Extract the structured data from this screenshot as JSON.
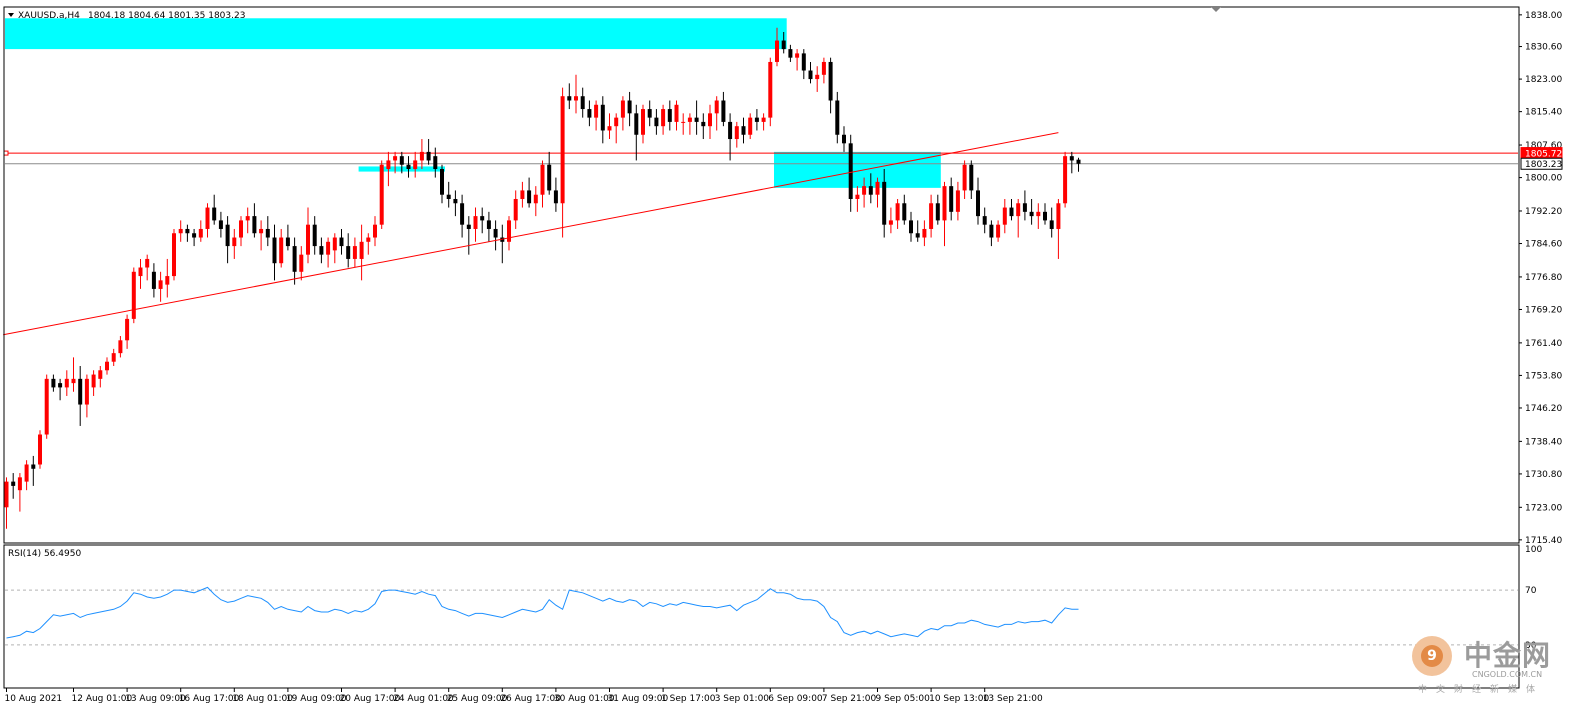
{
  "header": {
    "symbol": "XAUUSD.a,H4",
    "ohlc": "1804.18 1804.64 1801.35 1803.23"
  },
  "rsi": {
    "label": "RSI(14) 56.4950",
    "levels": [
      100,
      70,
      30
    ],
    "level_labels": [
      "100",
      "70",
      "30"
    ]
  },
  "watermark": {
    "brand": "中金网",
    "url": "CNGOLD.COM.CN",
    "tagline": "中文财经新媒体"
  },
  "colors": {
    "bull": "#ff0000",
    "bear": "#000000",
    "zone": "#00ffff",
    "trendline": "#ff0000",
    "rsi": "#1e90ff",
    "resistance_tag": "#ff0000",
    "bid_tag": "#ffffff"
  },
  "chart_data": {
    "type": "candlestick",
    "y_ticks": [
      1838.0,
      1830.6,
      1823.0,
      1815.4,
      1807.6,
      1800.0,
      1792.2,
      1784.6,
      1776.8,
      1769.2,
      1761.4,
      1753.8,
      1746.2,
      1738.4,
      1730.8,
      1723.0,
      1715.4
    ],
    "y_tick_labels": [
      "1838.00",
      "1830.60",
      "1823.00",
      "1815.40",
      "1807.60",
      "1800.00",
      "1792.20",
      "1784.60",
      "1776.80",
      "1769.20",
      "1761.40",
      "1753.80",
      "1746.20",
      "1738.40",
      "1730.80",
      "1723.00",
      "1715.40"
    ],
    "ylim": [
      1714.9,
      1839.6
    ],
    "x_labels": [
      "10 Aug 2021",
      "12 Aug 01:00",
      "13 Aug 09:00",
      "16 Aug 17:00",
      "18 Aug 01:00",
      "19 Aug 09:00",
      "20 Aug 17:00",
      "24 Aug 01:00",
      "25 Aug 09:00",
      "26 Aug 17:00",
      "30 Aug 01:00",
      "31 Aug 09:00",
      "1 Sep 17:00",
      "3 Sep 01:00",
      "6 Sep 09:00",
      "7 Sep 21:00",
      "9 Sep 05:00",
      "10 Sep 13:00",
      "13 Sep 21:00"
    ],
    "x_label_index": [
      0,
      10,
      18,
      26,
      34,
      42,
      50,
      58,
      66,
      74,
      82,
      90,
      98,
      106,
      114,
      122,
      130,
      138,
      146
    ],
    "price_tags": [
      {
        "label": "1805.72",
        "value": 1805.72,
        "style": "resistance"
      },
      {
        "label": "1803.23",
        "value": 1803.23,
        "style": "bid"
      }
    ],
    "zones": [
      {
        "from_bar": 0,
        "to_bar": 116,
        "low": 1830.0,
        "high": 1837.2
      },
      {
        "from_bar": 53,
        "to_bar": 65,
        "low": 1801.4,
        "high": 1802.6
      },
      {
        "from_bar": 115,
        "to_bar": 139,
        "low": 1797.6,
        "high": 1806.0
      }
    ],
    "trendline": {
      "x1_bar": -0.5,
      "y1": 1763.3,
      "x2_bar": 157,
      "y2": 1810.5
    },
    "ohlc": [
      [
        1723.0,
        1730.0,
        1718.0,
        1729.0
      ],
      [
        1729.0,
        1731.0,
        1725.0,
        1728.0
      ],
      [
        1727.0,
        1731.0,
        1722.0,
        1730.0
      ],
      [
        1729.0,
        1734.0,
        1727.0,
        1733.0
      ],
      [
        1733.0,
        1735.0,
        1728.0,
        1732.0
      ],
      [
        1733.0,
        1741.0,
        1732.0,
        1740.0
      ],
      [
        1740.0,
        1754.0,
        1739.0,
        1753.0
      ],
      [
        1753.0,
        1754.0,
        1750.0,
        1751.0
      ],
      [
        1752.0,
        1753.0,
        1748.0,
        1751.0
      ],
      [
        1751.0,
        1755.0,
        1749.0,
        1753.0
      ],
      [
        1752.0,
        1758.0,
        1750.0,
        1753.0
      ],
      [
        1753.0,
        1756.0,
        1742.0,
        1747.0
      ],
      [
        1747.0,
        1754.0,
        1744.0,
        1753.0
      ],
      [
        1751.0,
        1755.0,
        1749.0,
        1754.0
      ],
      [
        1753.0,
        1756.0,
        1751.0,
        1755.0
      ],
      [
        1755.0,
        1758.0,
        1754.0,
        1757.0
      ],
      [
        1757.0,
        1760.0,
        1756.0,
        1759.0
      ],
      [
        1759.0,
        1763.0,
        1758.0,
        1762.0
      ],
      [
        1762.0,
        1768.0,
        1760.0,
        1767.0
      ],
      [
        1767.0,
        1779.0,
        1766.0,
        1778.0
      ],
      [
        1777.0,
        1781.0,
        1774.0,
        1779.0
      ],
      [
        1779.0,
        1782.0,
        1776.0,
        1781.0
      ],
      [
        1778.0,
        1780.0,
        1772.0,
        1774.0
      ],
      [
        1774.0,
        1778.0,
        1771.0,
        1776.0
      ],
      [
        1775.0,
        1781.0,
        1772.0,
        1777.0
      ],
      [
        1777.0,
        1788.0,
        1776.0,
        1787.0
      ],
      [
        1787.0,
        1790.0,
        1785.0,
        1788.0
      ],
      [
        1788.0,
        1789.0,
        1785.0,
        1787.0
      ],
      [
        1787.0,
        1788.0,
        1784.0,
        1786.0
      ],
      [
        1786.0,
        1790.0,
        1785.0,
        1788.0
      ],
      [
        1788.0,
        1794.0,
        1786.0,
        1793.0
      ],
      [
        1793.0,
        1796.0,
        1789.0,
        1790.0
      ],
      [
        1790.0,
        1792.0,
        1786.0,
        1788.0
      ],
      [
        1789.0,
        1791.0,
        1780.0,
        1784.0
      ],
      [
        1784.0,
        1788.0,
        1781.0,
        1786.0
      ],
      [
        1786.0,
        1791.0,
        1784.0,
        1790.0
      ],
      [
        1790.0,
        1793.0,
        1787.0,
        1791.0
      ],
      [
        1791.0,
        1794.0,
        1786.0,
        1787.0
      ],
      [
        1787.0,
        1790.0,
        1783.0,
        1788.0
      ],
      [
        1788.0,
        1791.0,
        1784.0,
        1786.0
      ],
      [
        1786.0,
        1789.0,
        1776.0,
        1780.0
      ],
      [
        1780.0,
        1788.0,
        1779.0,
        1786.0
      ],
      [
        1786.0,
        1789.0,
        1783.0,
        1784.0
      ],
      [
        1784.0,
        1786.0,
        1775.0,
        1778.0
      ],
      [
        1778.0,
        1784.0,
        1776.0,
        1782.0
      ],
      [
        1782.0,
        1793.0,
        1780.0,
        1789.0
      ],
      [
        1789.0,
        1791.0,
        1782.0,
        1784.0
      ],
      [
        1784.0,
        1786.0,
        1780.0,
        1782.0
      ],
      [
        1782.0,
        1786.0,
        1779.0,
        1785.0
      ],
      [
        1783.0,
        1787.0,
        1780.0,
        1786.0
      ],
      [
        1786.0,
        1788.0,
        1782.0,
        1784.0
      ],
      [
        1784.0,
        1787.0,
        1779.0,
        1781.0
      ],
      [
        1781.0,
        1786.0,
        1779.0,
        1784.0
      ],
      [
        1781.0,
        1789.0,
        1776.0,
        1785.0
      ],
      [
        1785.0,
        1787.0,
        1782.0,
        1786.0
      ],
      [
        1786.0,
        1791.0,
        1784.0,
        1789.0
      ],
      [
        1789.0,
        1804.0,
        1788.0,
        1803.0
      ],
      [
        1802.0,
        1806.0,
        1798.0,
        1804.0
      ],
      [
        1804.0,
        1806.0,
        1801.0,
        1805.0
      ],
      [
        1805.0,
        1806.0,
        1801.0,
        1803.0
      ],
      [
        1803.0,
        1805.0,
        1800.0,
        1802.0
      ],
      [
        1802.0,
        1806.0,
        1800.0,
        1804.0
      ],
      [
        1804.0,
        1809.0,
        1802.0,
        1806.0
      ],
      [
        1806.0,
        1809.0,
        1803.0,
        1804.0
      ],
      [
        1805.0,
        1807.0,
        1800.0,
        1802.0
      ],
      [
        1802.0,
        1803.0,
        1794.0,
        1796.0
      ],
      [
        1796.0,
        1799.0,
        1793.0,
        1795.0
      ],
      [
        1795.0,
        1797.0,
        1791.0,
        1794.0
      ],
      [
        1794.0,
        1796.0,
        1786.0,
        1789.0
      ],
      [
        1789.0,
        1791.0,
        1782.0,
        1788.0
      ],
      [
        1788.0,
        1793.0,
        1785.0,
        1791.0
      ],
      [
        1791.0,
        1793.0,
        1787.0,
        1790.0
      ],
      [
        1790.0,
        1792.0,
        1785.0,
        1788.0
      ],
      [
        1788.0,
        1790.0,
        1783.0,
        1786.0
      ],
      [
        1786.0,
        1789.0,
        1780.0,
        1785.0
      ],
      [
        1785.0,
        1791.0,
        1783.0,
        1790.0
      ],
      [
        1790.0,
        1797.0,
        1788.0,
        1795.0
      ],
      [
        1795.0,
        1799.0,
        1793.0,
        1797.0
      ],
      [
        1797.0,
        1800.0,
        1793.0,
        1794.0
      ],
      [
        1794.0,
        1798.0,
        1791.0,
        1796.0
      ],
      [
        1796.0,
        1804.0,
        1793.0,
        1803.0
      ],
      [
        1803.0,
        1806.0,
        1796.0,
        1797.0
      ],
      [
        1797.0,
        1800.0,
        1792.0,
        1794.0
      ],
      [
        1794.0,
        1821.0,
        1786.0,
        1819.0
      ],
      [
        1819.0,
        1822.0,
        1816.0,
        1818.0
      ],
      [
        1818.0,
        1824.0,
        1815.0,
        1819.0
      ],
      [
        1819.0,
        1821.0,
        1814.0,
        1816.0
      ],
      [
        1816.0,
        1818.0,
        1812.0,
        1814.0
      ],
      [
        1814.0,
        1818.0,
        1811.0,
        1817.0
      ],
      [
        1817.0,
        1819.0,
        1808.0,
        1811.0
      ],
      [
        1811.0,
        1815.0,
        1809.0,
        1812.0
      ],
      [
        1812.0,
        1815.0,
        1808.0,
        1814.0
      ],
      [
        1814.0,
        1819.0,
        1811.0,
        1818.0
      ],
      [
        1818.0,
        1820.0,
        1812.0,
        1815.0
      ],
      [
        1815.0,
        1817.0,
        1804.0,
        1810.0
      ],
      [
        1810.0,
        1817.0,
        1808.0,
        1816.0
      ],
      [
        1816.0,
        1818.0,
        1812.0,
        1814.0
      ],
      [
        1814.0,
        1816.0,
        1810.0,
        1812.0
      ],
      [
        1812.0,
        1817.0,
        1810.0,
        1816.0
      ],
      [
        1816.0,
        1818.0,
        1811.0,
        1813.0
      ],
      [
        1813.0,
        1818.0,
        1811.0,
        1817.0
      ],
      [
        1813.0,
        1815.0,
        1810.0,
        1813.0
      ],
      [
        1813.0,
        1815.0,
        1810.0,
        1814.0
      ],
      [
        1814.0,
        1818.0,
        1810.0,
        1813.0
      ],
      [
        1813.0,
        1815.0,
        1809.0,
        1812.0
      ],
      [
        1812.0,
        1817.0,
        1809.0,
        1815.0
      ],
      [
        1815.0,
        1819.0,
        1811.0,
        1818.0
      ],
      [
        1818.0,
        1820.0,
        1812.0,
        1813.0
      ],
      [
        1813.0,
        1815.0,
        1804.0,
        1809.0
      ],
      [
        1809.0,
        1813.0,
        1807.0,
        1812.0
      ],
      [
        1812.0,
        1814.0,
        1808.0,
        1810.0
      ],
      [
        1810.0,
        1815.0,
        1809.0,
        1814.0
      ],
      [
        1814.0,
        1816.0,
        1811.0,
        1813.0
      ],
      [
        1813.0,
        1815.0,
        1811.0,
        1814.0
      ],
      [
        1814.0,
        1828.0,
        1812.0,
        1827.0
      ],
      [
        1827.0,
        1835.0,
        1826.0,
        1832.0
      ],
      [
        1832.0,
        1834.0,
        1829.0,
        1830.0
      ],
      [
        1830.0,
        1831.0,
        1827.0,
        1828.0
      ],
      [
        1828.0,
        1830.0,
        1825.0,
        1829.0
      ],
      [
        1829.0,
        1830.0,
        1823.0,
        1825.0
      ],
      [
        1825.0,
        1827.0,
        1822.0,
        1823.0
      ],
      [
        1823.0,
        1826.0,
        1820.0,
        1824.0
      ],
      [
        1824.0,
        1828.0,
        1822.0,
        1827.0
      ],
      [
        1827.0,
        1828.0,
        1815.0,
        1818.0
      ],
      [
        1818.0,
        1820.0,
        1808.0,
        1810.0
      ],
      [
        1810.0,
        1812.0,
        1806.0,
        1808.0
      ],
      [
        1808.0,
        1810.0,
        1792.0,
        1795.0
      ],
      [
        1795.0,
        1798.0,
        1792.0,
        1796.0
      ],
      [
        1796.0,
        1800.0,
        1793.0,
        1798.0
      ],
      [
        1798.0,
        1801.0,
        1794.0,
        1796.0
      ],
      [
        1796.0,
        1800.0,
        1793.0,
        1799.0
      ],
      [
        1799.0,
        1802.0,
        1786.0,
        1789.0
      ],
      [
        1789.0,
        1793.0,
        1787.0,
        1790.0
      ],
      [
        1790.0,
        1795.0,
        1788.0,
        1794.0
      ],
      [
        1794.0,
        1796.0,
        1789.0,
        1790.0
      ],
      [
        1790.0,
        1792.0,
        1785.0,
        1787.0
      ],
      [
        1787.0,
        1790.0,
        1785.0,
        1786.0
      ],
      [
        1786.0,
        1790.0,
        1784.0,
        1788.0
      ],
      [
        1788.0,
        1796.0,
        1786.0,
        1794.0
      ],
      [
        1794.0,
        1796.0,
        1789.0,
        1790.0
      ],
      [
        1790.0,
        1799.0,
        1784.0,
        1798.0
      ],
      [
        1798.0,
        1800.0,
        1790.0,
        1792.0
      ],
      [
        1792.0,
        1799.0,
        1790.0,
        1797.0
      ],
      [
        1797.0,
        1804.0,
        1795.0,
        1803.0
      ],
      [
        1803.0,
        1804.0,
        1795.0,
        1797.0
      ],
      [
        1797.0,
        1800.0,
        1789.0,
        1791.0
      ],
      [
        1791.0,
        1793.0,
        1787.0,
        1789.0
      ],
      [
        1789.0,
        1790.0,
        1784.0,
        1786.0
      ],
      [
        1786.0,
        1790.0,
        1785.0,
        1789.0
      ],
      [
        1789.0,
        1795.0,
        1787.0,
        1793.0
      ],
      [
        1793.0,
        1795.0,
        1790.0,
        1791.0
      ],
      [
        1791.0,
        1795.0,
        1786.0,
        1794.0
      ],
      [
        1794.0,
        1797.0,
        1790.0,
        1792.0
      ],
      [
        1792.0,
        1795.0,
        1789.0,
        1791.0
      ],
      [
        1791.0,
        1794.0,
        1788.0,
        1792.0
      ],
      [
        1792.0,
        1794.0,
        1789.0,
        1790.0
      ],
      [
        1790.0,
        1793.0,
        1786.0,
        1788.0
      ],
      [
        1788.0,
        1795.0,
        1781.0,
        1794.0
      ],
      [
        1794.0,
        1806.0,
        1793.0,
        1805.0
      ],
      [
        1805.0,
        1806.0,
        1801.0,
        1804.0
      ],
      [
        1804.18,
        1804.64,
        1801.35,
        1803.23
      ]
    ],
    "rsi_values": [
      35,
      36,
      37,
      40,
      39,
      42,
      47,
      52,
      51,
      52,
      53,
      50,
      52,
      53,
      54,
      55,
      56,
      58,
      62,
      68,
      67,
      65,
      64,
      65,
      67,
      70,
      70,
      69,
      68,
      70,
      72,
      67,
      63,
      61,
      62,
      64,
      66,
      65,
      64,
      61,
      56,
      58,
      56,
      55,
      54,
      58,
      55,
      54,
      54,
      56,
      55,
      53,
      55,
      54,
      56,
      60,
      69,
      70,
      70,
      69,
      68,
      67,
      69,
      67,
      66,
      58,
      56,
      55,
      53,
      51,
      53,
      53,
      52,
      51,
      50,
      52,
      54,
      56,
      55,
      54,
      56,
      63,
      59,
      56,
      70,
      69,
      68,
      66,
      64,
      62,
      64,
      62,
      61,
      63,
      62,
      58,
      61,
      60,
      58,
      60,
      59,
      61,
      60,
      59,
      58,
      58,
      57,
      58,
      59,
      55,
      59,
      61,
      63,
      67,
      71,
      68,
      68,
      67,
      64,
      63,
      63,
      62,
      58,
      50,
      47,
      39,
      37,
      39,
      40,
      38,
      40,
      38,
      36,
      37,
      38,
      37,
      36,
      40,
      42,
      41,
      44,
      44,
      46,
      46,
      48,
      47,
      45,
      44,
      43,
      45,
      45,
      47,
      46,
      47,
      47,
      48,
      46,
      52,
      57,
      56,
      56
    ]
  }
}
